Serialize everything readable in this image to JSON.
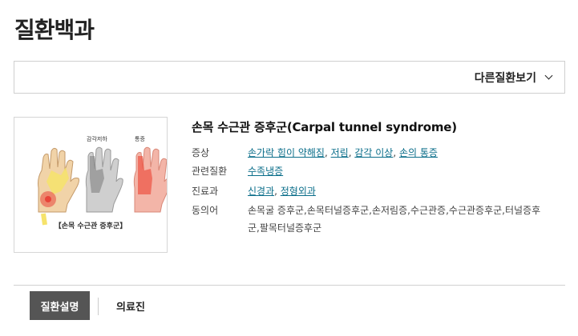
{
  "page": {
    "title": "질환백과"
  },
  "other_disease": {
    "label": "다른질환보기",
    "icon": "chevron-down-icon"
  },
  "thumbnail": {
    "caption": "【손목 수근관 증후군】",
    "label_numb": "감각저하",
    "label_pain": "통증"
  },
  "disease": {
    "title": "손목 수근관 증후군(Carpal tunnel syndrome)",
    "symptoms": {
      "label": "증상",
      "items": [
        "손가락 힘이 약해짐",
        "저림",
        "감각 이상",
        "손의 통증"
      ]
    },
    "related": {
      "label": "관련질환",
      "items": [
        "수족냉증"
      ]
    },
    "departments": {
      "label": "진료과",
      "items": [
        "신경과",
        "정형외과"
      ]
    },
    "synonyms": {
      "label": "동의어",
      "line1": "손목굴 증후군,손목터널증후군,손저림증,수근관증,수근관증후군,터널증후",
      "line2": "군,팔목터널증후군"
    }
  },
  "tabs": [
    {
      "label": "질환설명",
      "active": true
    },
    {
      "label": "의료진",
      "active": false
    }
  ],
  "colors": {
    "link": "#0b6e8a",
    "active_tab": "#555555",
    "border": "#cfcfcf"
  }
}
